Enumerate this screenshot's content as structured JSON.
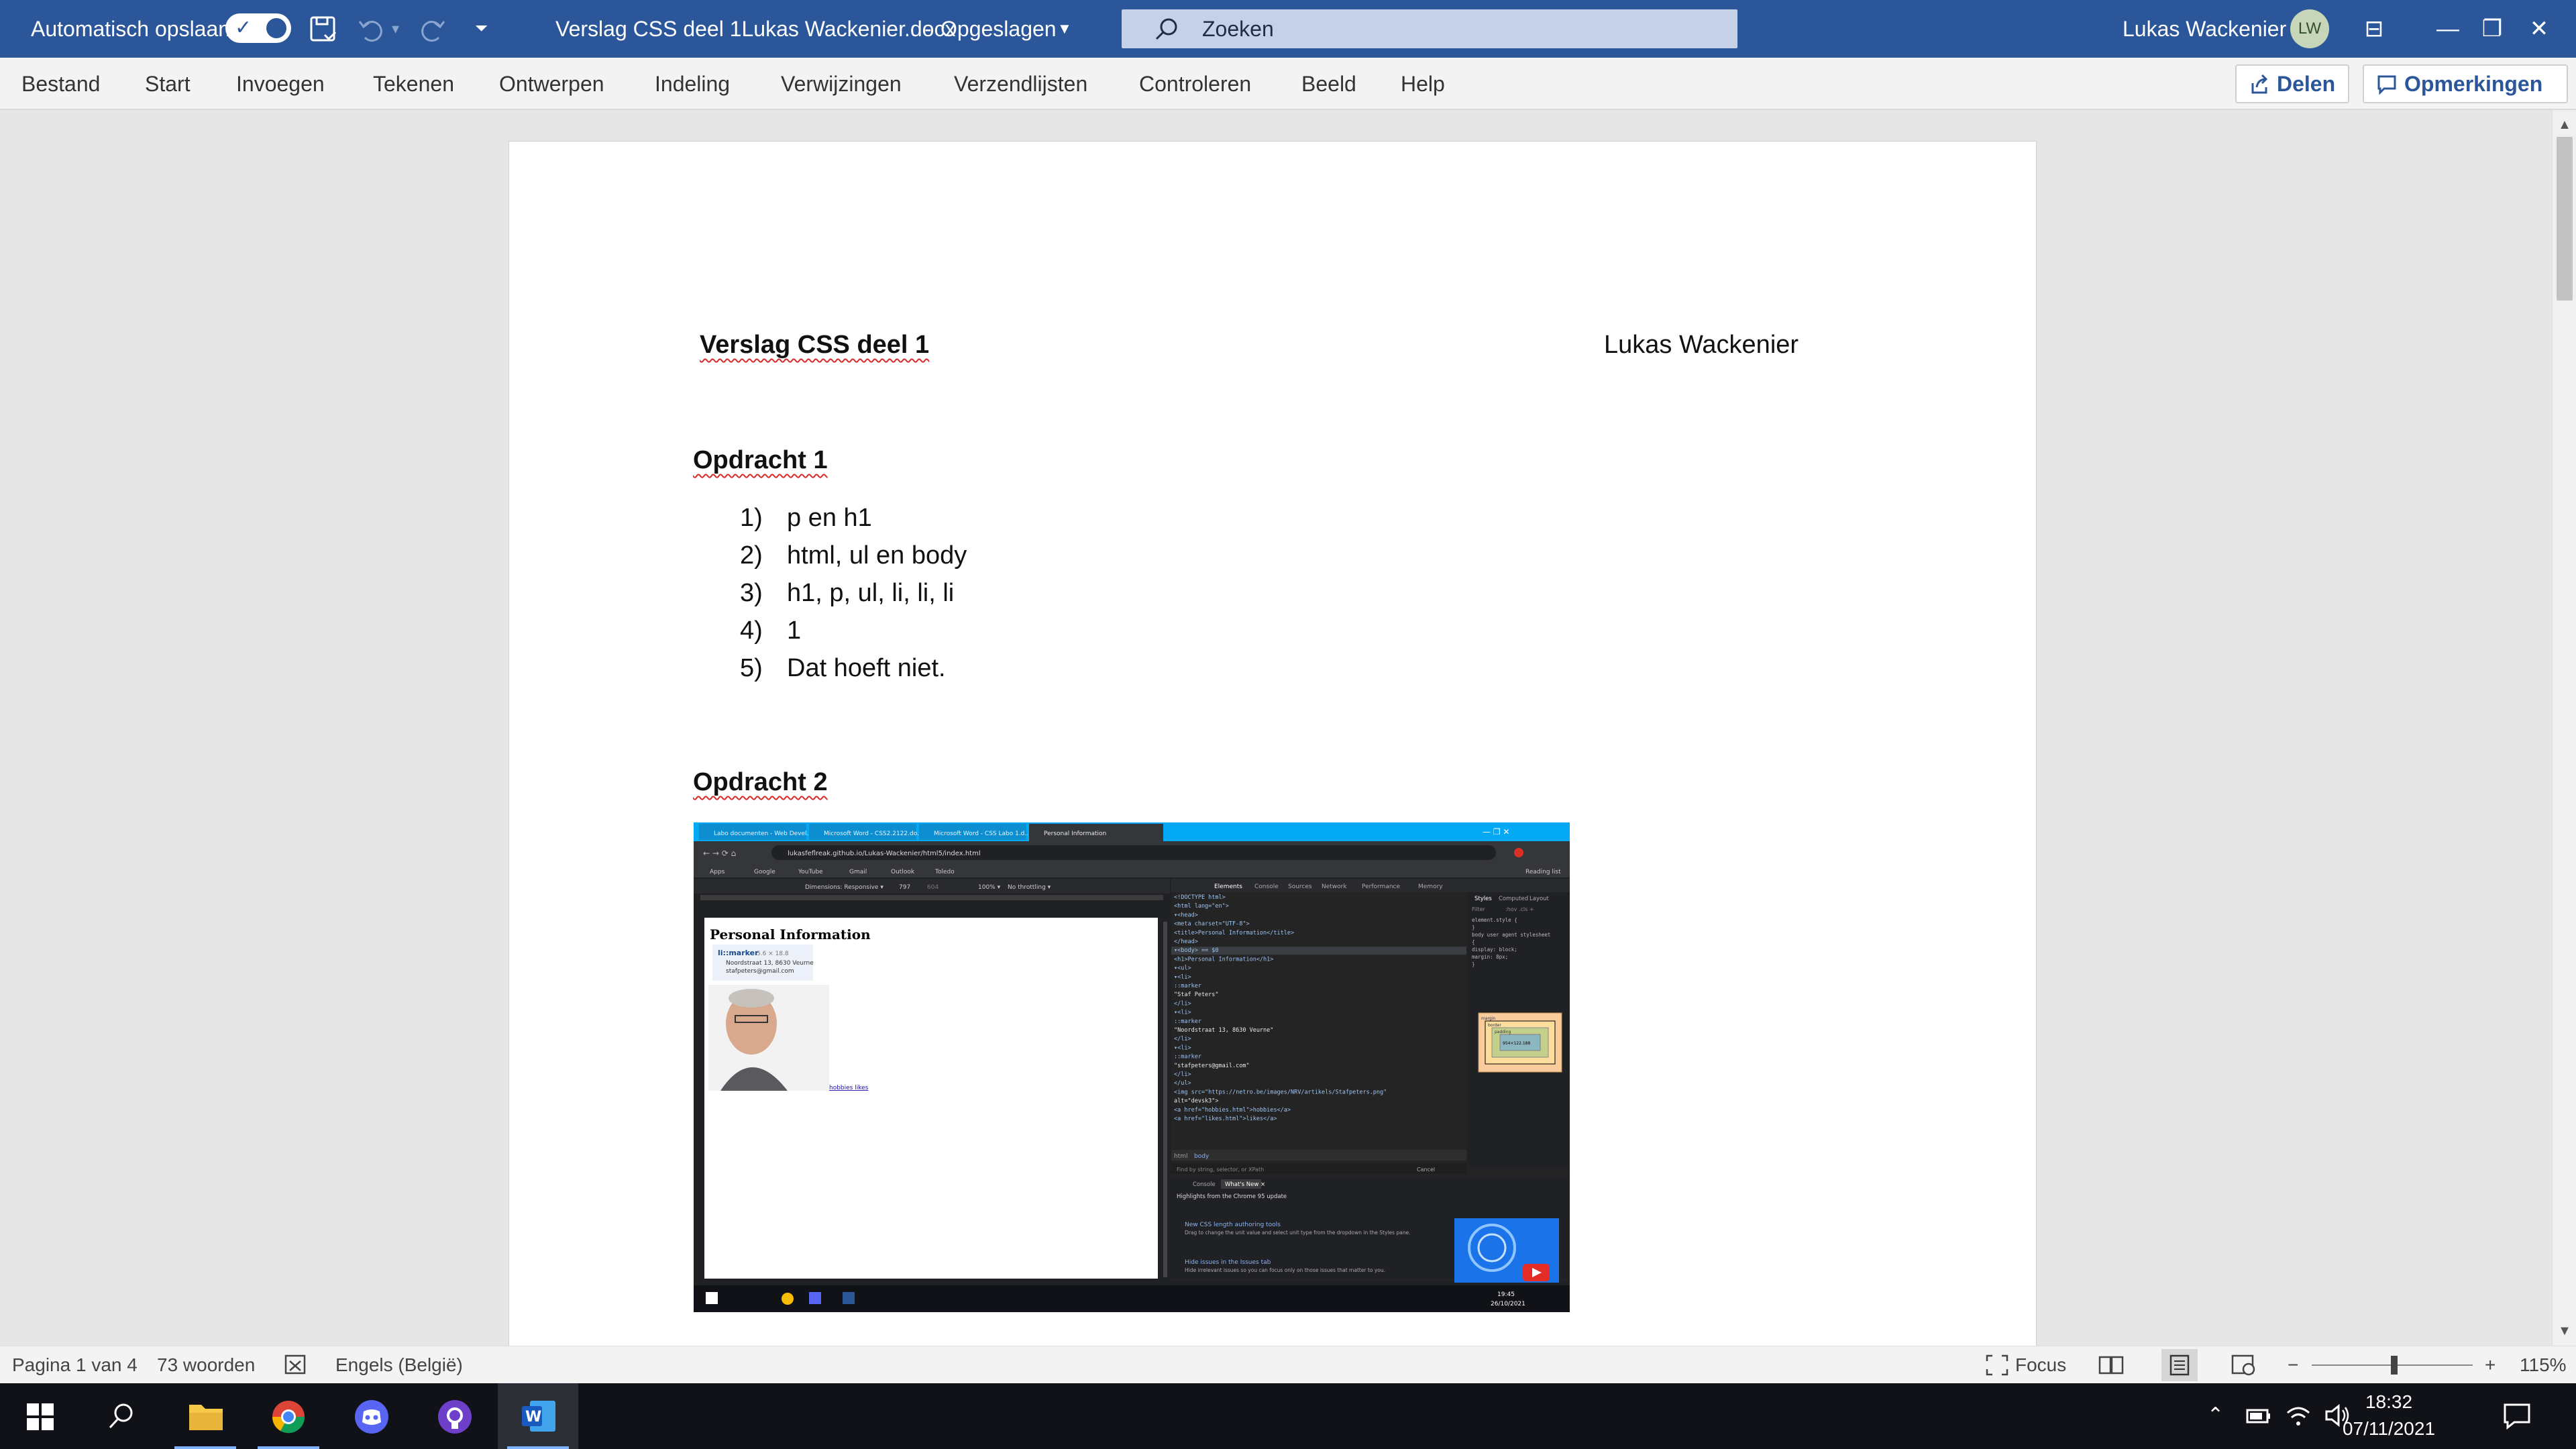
{
  "titlebar": {
    "autosave_label": "Automatisch opslaan",
    "document_name": "Verslag CSS deel 1Lukas Wackenier.docx",
    "separator": "-",
    "save_state": "Opgeslagen",
    "search_label": "Zoeken",
    "user_name": "Lukas Wackenier",
    "user_initials": "LW",
    "accent": "#2b579a"
  },
  "ribbon": {
    "tabs": [
      "Bestand",
      "Start",
      "Invoegen",
      "Tekenen",
      "Ontwerpen",
      "Indeling",
      "Verwijzingen",
      "Verzendlijsten",
      "Controleren",
      "Beeld",
      "Help"
    ],
    "share_label": "Delen",
    "comments_label": "Opmerkingen"
  },
  "document": {
    "header_left": "Verslag CSS deel 1",
    "header_right": "Lukas Wackenier",
    "section1_title": "Opdracht 1",
    "list1": [
      {
        "num": "1)",
        "text": "p en h1"
      },
      {
        "num": "2)",
        "text": "html, ul en body"
      },
      {
        "num": "3)",
        "text": "h1, p, ul, li, li, li"
      },
      {
        "num": "4)",
        "text": "1"
      },
      {
        "num": "5)",
        "text": "Dat hoeft niet."
      }
    ],
    "section2_title": "Opdracht 2"
  },
  "embedded_screenshot": {
    "tabs": [
      "Labo documenten - Web Devel...",
      "Microsoft Word - CSS2.2122.do...",
      "Microsoft Word - CSS Labo 1.d...",
      "Personal Information"
    ],
    "address": "lukasfeflreak.github.io/Lukas-Wackenier/html5/index.html",
    "bookmarks": [
      "Apps",
      "Google",
      "YouTube",
      "Gmail",
      "Outlook",
      "Toledo",
      "Reading list"
    ],
    "device_toolbar": [
      "Dimensions: Responsive ▾",
      "797",
      "604",
      "100% ▾",
      "No throttling ▾"
    ],
    "page_heading": "Personal Information",
    "page_marker": "li::marker",
    "page_marker_size": "5.6 × 18.8",
    "page_lines": [
      "Noordstraat 13, 8630 Veurne",
      "stafpeters@gmail.com"
    ],
    "page_links": "hobbies likes",
    "devtools_tabs": [
      "Elements",
      "Console",
      "Sources",
      "Network",
      "Performance",
      "Memory"
    ],
    "styles_tabs": [
      "Styles",
      "Computed",
      "Layout"
    ],
    "styles_filter": "Filter",
    "styles_hov": ":hov .cls +",
    "styles_lines": [
      "element.style {",
      "}",
      "body    user agent stylesheet",
      "{",
      "  display: block;",
      "  margin: 8px;",
      "}"
    ],
    "boxmodel": [
      "margin",
      "border",
      "padding",
      "954×122.188"
    ],
    "code_lines": [
      "<!DOCTYPE html>",
      "<html lang=\"en\">",
      "▾<head>",
      "  <meta charset=\"UTF-8\">",
      "  <title>Personal Information</title>",
      "</head>",
      "▾<body> == $0",
      "  <h1>Personal Information</h1>",
      "  ▾<ul>",
      "    ▾<li>",
      "      ::marker",
      "      \"Staf Peters\"",
      "    </li>",
      "    ▾<li>",
      "      ::marker",
      "      \"Noordstraat 13, 8630 Veurne\"",
      "    </li>",
      "    ▾<li>",
      "      ::marker",
      "      \"stafpeters@gmail.com\"",
      "    </li>",
      "  </ul>",
      "  <img src=\"https://netro.be/images/NRV/artikels/Stafpeters.png\"",
      "  alt=\"devsk3\">",
      "  <a href=\"hobbies.html\">hobbies</a>",
      "  <a href=\"likes.html\">likes</a>"
    ],
    "breadcrumb": [
      "html",
      "body"
    ],
    "find_placeholder": "Find by string, selector, or XPath",
    "cancel_label": "Cancel",
    "drawer_tabs": [
      "Console",
      "What's New ×"
    ],
    "whats_new_heading": "Highlights from the Chrome 95 update",
    "news": [
      {
        "title": "New CSS length authoring tools",
        "desc": "Drag to change the unit value and select unit type from the dropdown in the Styles pane."
      },
      {
        "title": "Hide issues in the Issues tab",
        "desc": "Hide irrelevant issues so you can focus only on those issues that matter to you."
      }
    ],
    "taskbar_time": "19:45",
    "taskbar_date": "26/10/2021"
  },
  "statusbar": {
    "page": "Pagina 1 van 4",
    "words": "73 woorden",
    "language": "Engels (België)",
    "focus": "Focus",
    "zoom": "115%",
    "zoom_minus": "−",
    "zoom_plus": "+"
  },
  "taskbar": {
    "time": "18:32",
    "date": "07/11/2021"
  }
}
